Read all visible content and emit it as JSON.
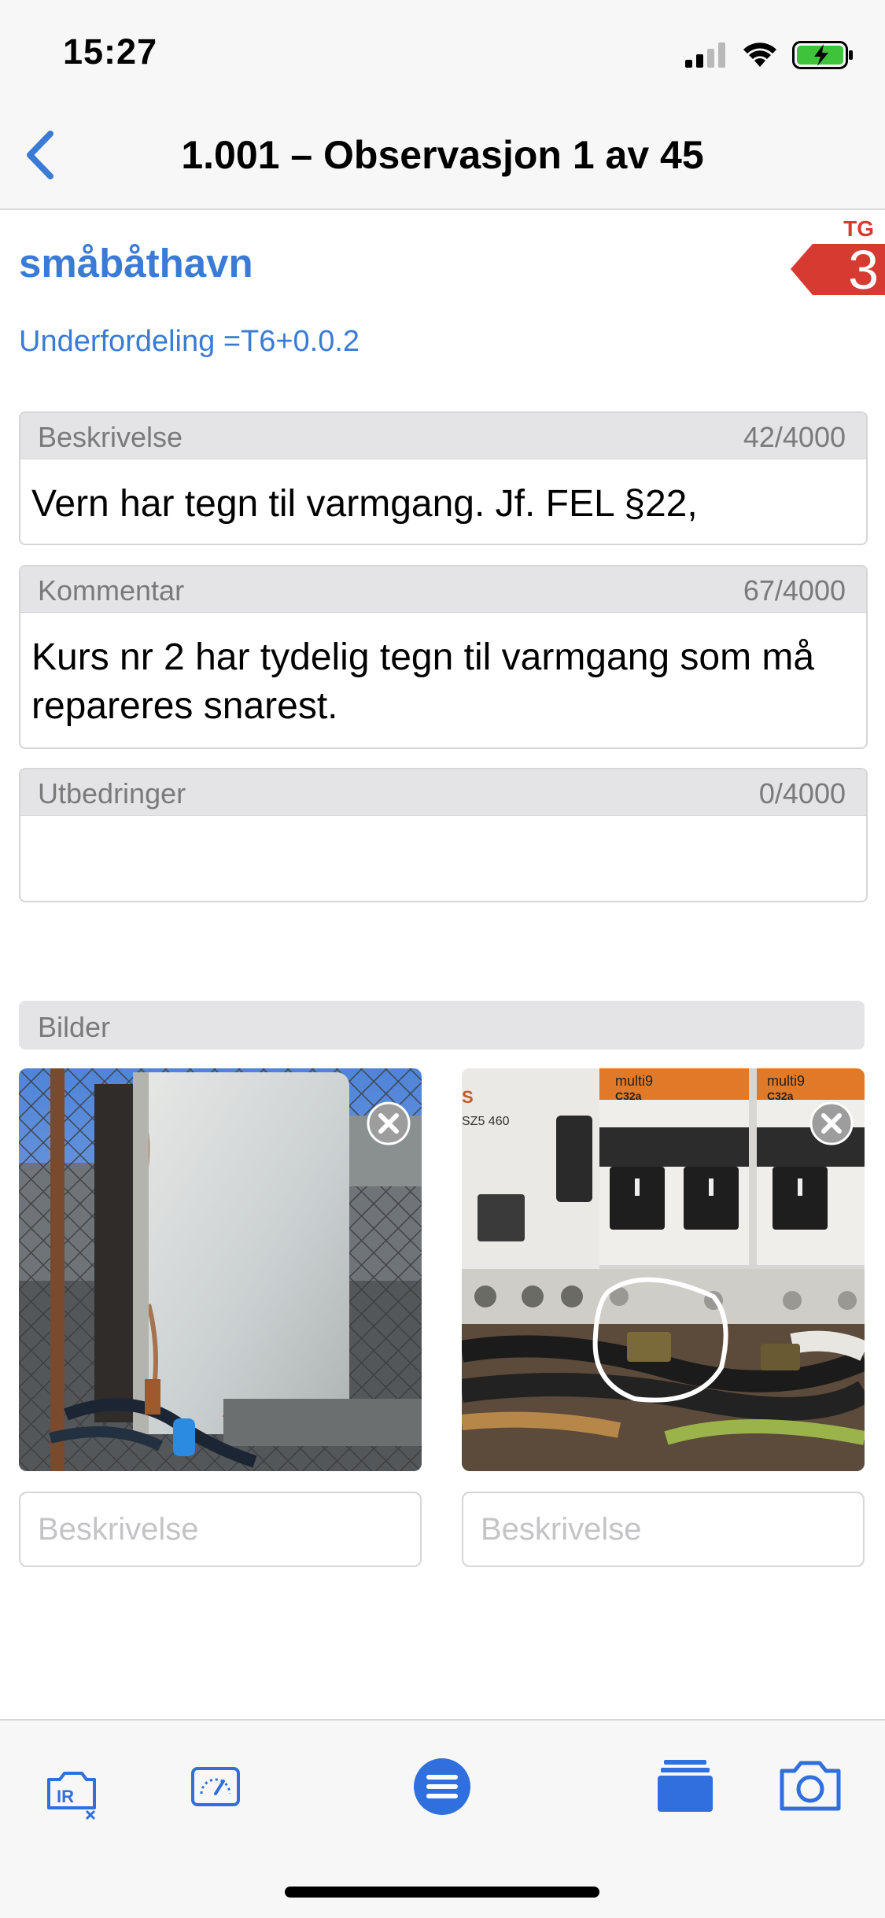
{
  "status_bar": {
    "time": "15:27"
  },
  "nav": {
    "title": "1.001 – Observasjon 1 av 45"
  },
  "header": {
    "place": "småbåthavn",
    "subtitle": "Underfordeling =T6+0.0.2",
    "tg_label": "TG",
    "tg_value": "3"
  },
  "fields": {
    "beskrivelse": {
      "label": "Beskrivelse",
      "count": "42/4000",
      "value": "Vern har tegn til varmgang. Jf. FEL §22,"
    },
    "kommentar": {
      "label": "Kommentar",
      "count": "67/4000",
      "value": "Kurs nr 2 har tydelig tegn til varmgang som må repareres snarest."
    },
    "utbedringer": {
      "label": "Utbedringer",
      "count": "0/4000",
      "value": ""
    }
  },
  "images": {
    "label": "Bilder",
    "items": [
      {
        "placeholder": "Beskrivelse"
      },
      {
        "placeholder": "Beskrivelse",
        "photo_text": {
          "s": "S",
          "model": "SZ5 460",
          "brand_left": "multi9",
          "brand_right": "multi9",
          "rating_left": "C32a",
          "rating_right": "C32a"
        }
      }
    ]
  },
  "colors": {
    "accent": "#3a7bd5",
    "tg": "#d63a30",
    "toolbar_icon": "#2f6fde"
  },
  "icons": [
    "chevron-left-icon",
    "signal-icon",
    "wifi-icon",
    "battery-charging-icon",
    "ir-camera-icon",
    "gauge-icon",
    "menu-icon",
    "layers-icon",
    "camera-icon",
    "remove-icon"
  ]
}
